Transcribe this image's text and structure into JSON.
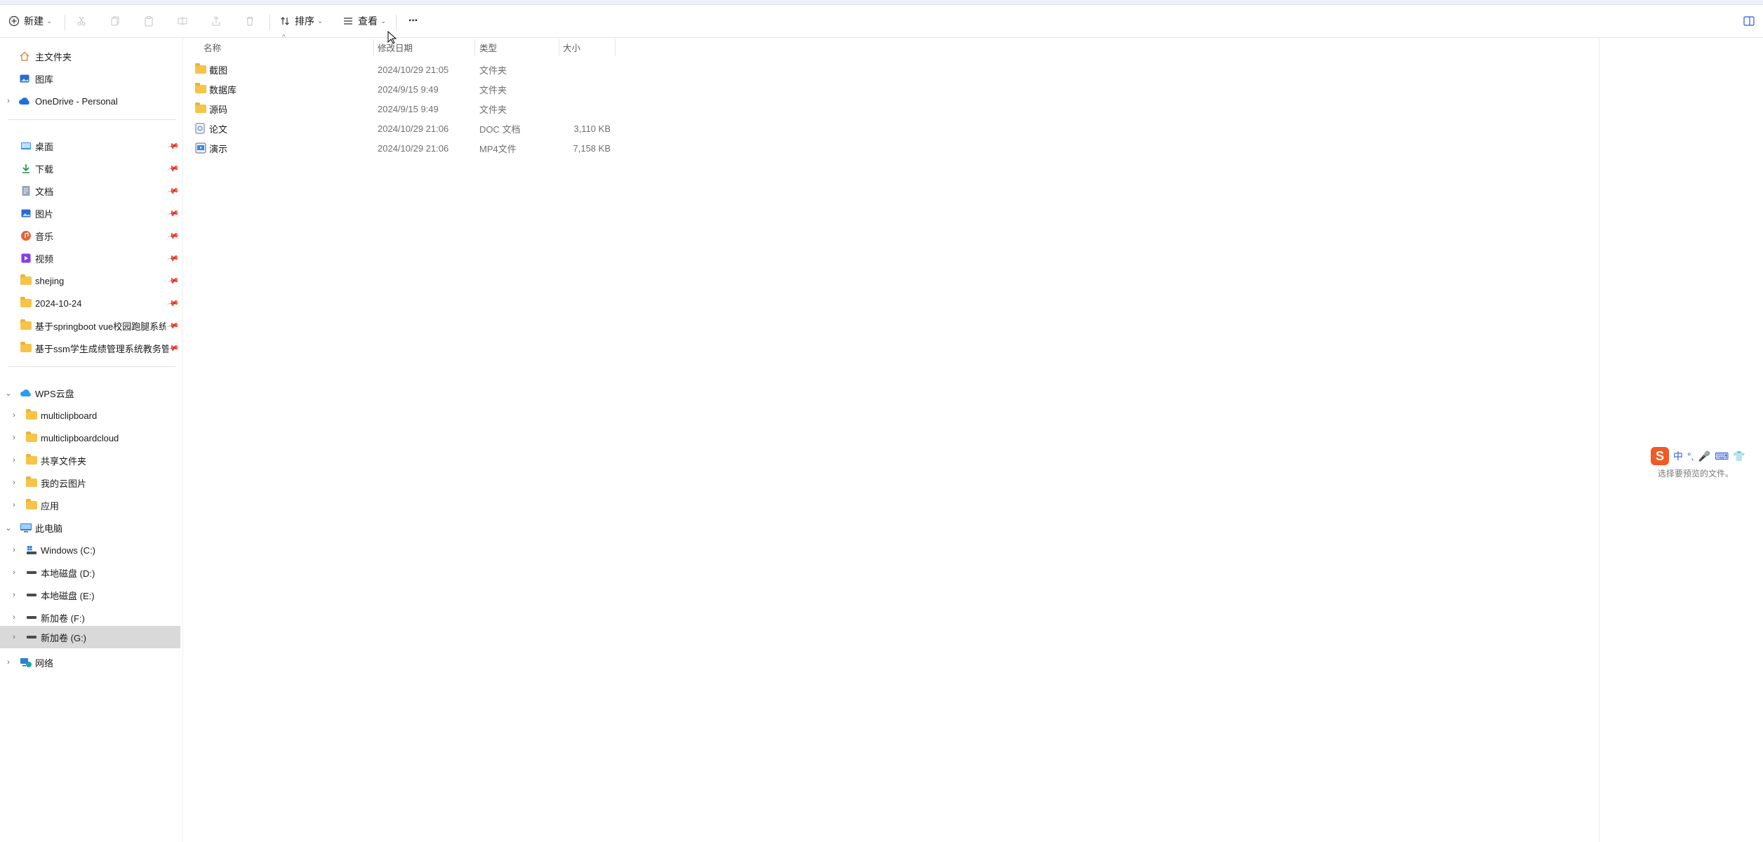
{
  "toolbar": {
    "new_label": "新建",
    "sort_label": "排序",
    "view_label": "查看",
    "more_label": "···"
  },
  "sidebar": {
    "top": [
      {
        "label": "主文件夹",
        "icon": "home-icon"
      },
      {
        "label": "图库",
        "icon": "gallery-icon"
      },
      {
        "label": "OneDrive - Personal",
        "icon": "cloud-icon"
      }
    ],
    "quick_access": [
      {
        "label": "桌面",
        "icon": "desktop-icon"
      },
      {
        "label": "下载",
        "icon": "download-icon"
      },
      {
        "label": "文档",
        "icon": "document-icon"
      },
      {
        "label": "图片",
        "icon": "pictures-icon"
      },
      {
        "label": "音乐",
        "icon": "music-icon"
      },
      {
        "label": "视频",
        "icon": "video-icon"
      },
      {
        "label": "shejing",
        "icon": "folder-icon"
      },
      {
        "label": "2024-10-24",
        "icon": "folder-icon"
      },
      {
        "label": "基于springboot vue校园跑腿系统",
        "icon": "folder-icon"
      },
      {
        "label": "基于ssm学生成绩管理系统教务管理",
        "icon": "folder-icon"
      }
    ],
    "wps": {
      "label": "WPS云盘",
      "children": [
        "multiclipboard",
        "multiclipboardcloud",
        "共享文件夹",
        "我的云图片",
        "应用"
      ]
    },
    "this_pc": {
      "label": "此电脑",
      "children": [
        "Windows (C:)",
        "本地磁盘 (D:)",
        "本地磁盘 (E:)",
        "新加卷 (F:)",
        "新加卷 (G:)"
      ]
    },
    "network": {
      "label": "网络"
    }
  },
  "columns": {
    "name": "名称",
    "date": "修改日期",
    "type": "类型",
    "size": "大小"
  },
  "files": [
    {
      "name": "截图",
      "date": "2024/10/29 21:05",
      "type": "文件夹",
      "size": "",
      "icon": "folder-icon"
    },
    {
      "name": "数据库",
      "date": "2024/9/15 9:49",
      "type": "文件夹",
      "size": "",
      "icon": "folder-icon"
    },
    {
      "name": "源码",
      "date": "2024/9/15 9:49",
      "type": "文件夹",
      "size": "",
      "icon": "folder-icon"
    },
    {
      "name": "论文",
      "date": "2024/10/29 21:06",
      "type": "DOC 文档",
      "size": "3,110 KB",
      "icon": "doc-file-icon"
    },
    {
      "name": "演示",
      "date": "2024/10/29 21:06",
      "type": "MP4文件",
      "size": "7,158 KB",
      "icon": "video-file-icon"
    }
  ],
  "preview": {
    "message": "选择要预览的文件。"
  },
  "ime": {
    "mode": "中"
  }
}
